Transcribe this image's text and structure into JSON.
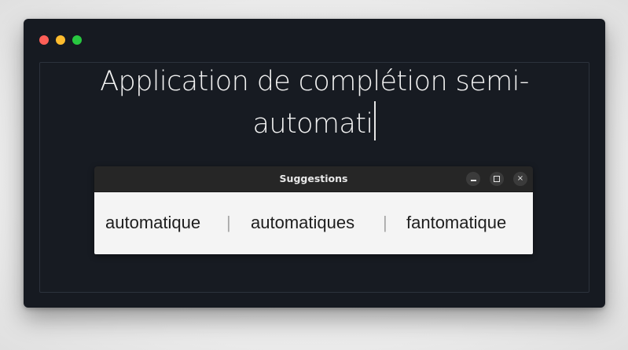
{
  "window": {
    "traffic_lights": [
      "close",
      "minimize",
      "zoom"
    ],
    "colors": {
      "background": "#161a21",
      "red": "#ff5f57",
      "yellow": "#febc2e",
      "green": "#28c840"
    }
  },
  "editor": {
    "line1": "Application de complétion semi-",
    "line2": "automati"
  },
  "suggestions_popup": {
    "title": "Suggestions",
    "controls": {
      "minimize": "minimize-icon",
      "maximize": "maximize-icon",
      "close": "×"
    },
    "items": [
      "automatique",
      "automatiques",
      "fantomatique"
    ],
    "separator": "|"
  }
}
